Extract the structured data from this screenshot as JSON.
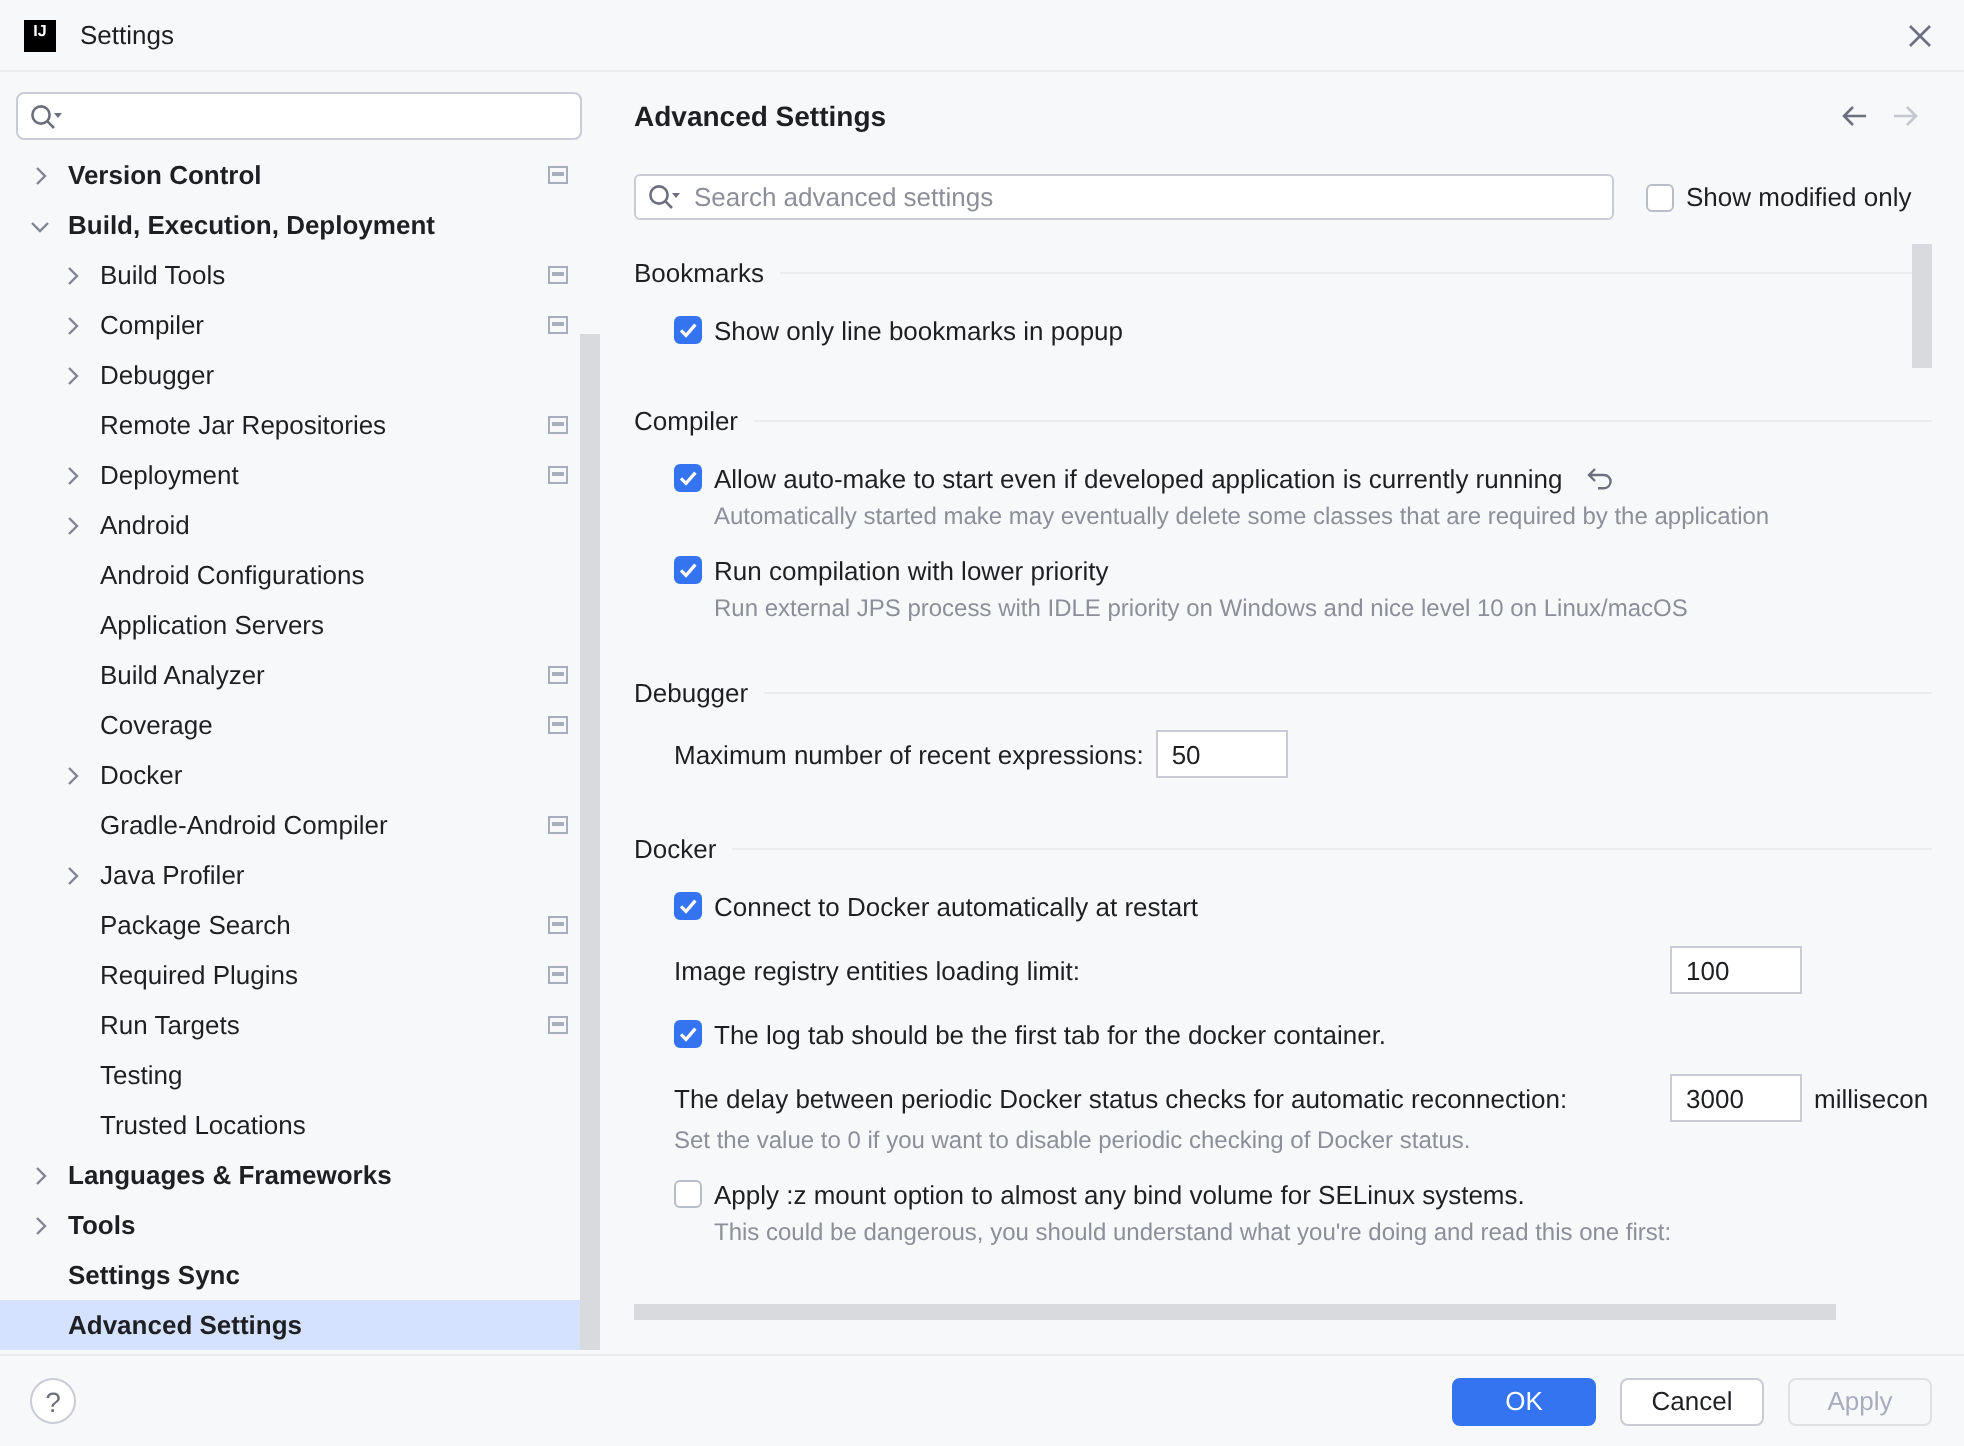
{
  "window": {
    "app_icon_text": "IJ",
    "title": "Settings"
  },
  "sidebar": {
    "items": [
      {
        "label": "Version Control",
        "kind": "group",
        "expanded": false,
        "selected": false,
        "project_scoped": true
      },
      {
        "label": "Build, Execution, Deployment",
        "kind": "group",
        "expanded": true,
        "selected": false,
        "project_scoped": false,
        "children": [
          {
            "label": "Build Tools",
            "kind": "group",
            "expanded": false,
            "selected": false,
            "project_scoped": true
          },
          {
            "label": "Compiler",
            "kind": "group",
            "expanded": false,
            "selected": false,
            "project_scoped": true
          },
          {
            "label": "Debugger",
            "kind": "group",
            "expanded": false,
            "selected": false,
            "project_scoped": false
          },
          {
            "label": "Remote Jar Repositories",
            "kind": "leaf",
            "selected": false,
            "project_scoped": true
          },
          {
            "label": "Deployment",
            "kind": "group",
            "expanded": false,
            "selected": false,
            "project_scoped": true
          },
          {
            "label": "Android",
            "kind": "group",
            "expanded": false,
            "selected": false,
            "project_scoped": false
          },
          {
            "label": "Android Configurations",
            "kind": "leaf",
            "selected": false,
            "project_scoped": false
          },
          {
            "label": "Application Servers",
            "kind": "leaf",
            "selected": false,
            "project_scoped": false
          },
          {
            "label": "Build Analyzer",
            "kind": "leaf",
            "selected": false,
            "project_scoped": true
          },
          {
            "label": "Coverage",
            "kind": "leaf",
            "selected": false,
            "project_scoped": true
          },
          {
            "label": "Docker",
            "kind": "group",
            "expanded": false,
            "selected": false,
            "project_scoped": false
          },
          {
            "label": "Gradle-Android Compiler",
            "kind": "leaf",
            "selected": false,
            "project_scoped": true
          },
          {
            "label": "Java Profiler",
            "kind": "group",
            "expanded": false,
            "selected": false,
            "project_scoped": false
          },
          {
            "label": "Package Search",
            "kind": "leaf",
            "selected": false,
            "project_scoped": true
          },
          {
            "label": "Required Plugins",
            "kind": "leaf",
            "selected": false,
            "project_scoped": true
          },
          {
            "label": "Run Targets",
            "kind": "leaf",
            "selected": false,
            "project_scoped": true
          },
          {
            "label": "Testing",
            "kind": "leaf",
            "selected": false,
            "project_scoped": false
          },
          {
            "label": "Trusted Locations",
            "kind": "leaf",
            "selected": false,
            "project_scoped": false
          }
        ]
      },
      {
        "label": "Languages & Frameworks",
        "kind": "group",
        "expanded": false,
        "selected": false,
        "project_scoped": false
      },
      {
        "label": "Tools",
        "kind": "group",
        "expanded": false,
        "selected": false,
        "project_scoped": false
      },
      {
        "label": "Settings Sync",
        "kind": "leaf",
        "selected": false,
        "project_scoped": false
      },
      {
        "label": "Advanced Settings",
        "kind": "leaf",
        "selected": true,
        "project_scoped": false
      }
    ]
  },
  "content": {
    "title": "Advanced Settings",
    "navigation": [
      {
        "kind": "back",
        "disabled": false
      },
      {
        "kind": "forward",
        "disabled": true
      }
    ],
    "search": {
      "placeholder": "Search advanced settings"
    },
    "show_modified_only": {
      "label": "Show modified only",
      "checked": false
    },
    "sections": [
      {
        "title": "Bookmarks",
        "items": [
          {
            "kind": "checkbox",
            "label": "Show only line bookmarks in popup",
            "checked": true,
            "modified": false
          }
        ]
      },
      {
        "title": "Compiler",
        "items": [
          {
            "kind": "checkbox",
            "label": "Allow auto-make to start even if developed application is currently running",
            "checked": true,
            "modified": true,
            "description": "Automatically started make may eventually delete some classes that are required by the application"
          },
          {
            "kind": "checkbox",
            "label": "Run compilation with lower priority",
            "checked": true,
            "modified": false,
            "description": "Run external JPS process with IDLE priority on Windows and nice level 10 on Linux/macOS"
          }
        ]
      },
      {
        "title": "Debugger",
        "items": [
          {
            "kind": "number",
            "label": "Maximum number of recent expressions:",
            "value": "50"
          }
        ]
      },
      {
        "title": "Docker",
        "items": [
          {
            "kind": "checkbox",
            "label": "Connect to Docker automatically at restart",
            "checked": true,
            "modified": false
          },
          {
            "kind": "number",
            "label": "Image registry entities loading limit:",
            "value": "100"
          },
          {
            "kind": "checkbox",
            "label": "The log tab should be the first tab for the docker container.",
            "checked": true,
            "modified": false
          },
          {
            "kind": "number",
            "label": "The delay between periodic Docker status checks for automatic reconnection:",
            "value": "3000",
            "unit": "millisecon",
            "description": "Set the value to 0 if you want to disable periodic checking of Docker status."
          },
          {
            "kind": "checkbox",
            "label": "Apply :z mount option to almost any bind volume for SELinux systems.",
            "checked": false,
            "modified": false,
            "description": "This could be dangerous, you should understand what you're doing and read this one first:"
          }
        ]
      }
    ]
  },
  "footer": {
    "help": "?",
    "buttons": [
      {
        "label": "OK",
        "kind": "primary",
        "disabled": false
      },
      {
        "label": "Cancel",
        "kind": "default",
        "disabled": false
      },
      {
        "label": "Apply",
        "kind": "default",
        "disabled": true
      }
    ]
  }
}
